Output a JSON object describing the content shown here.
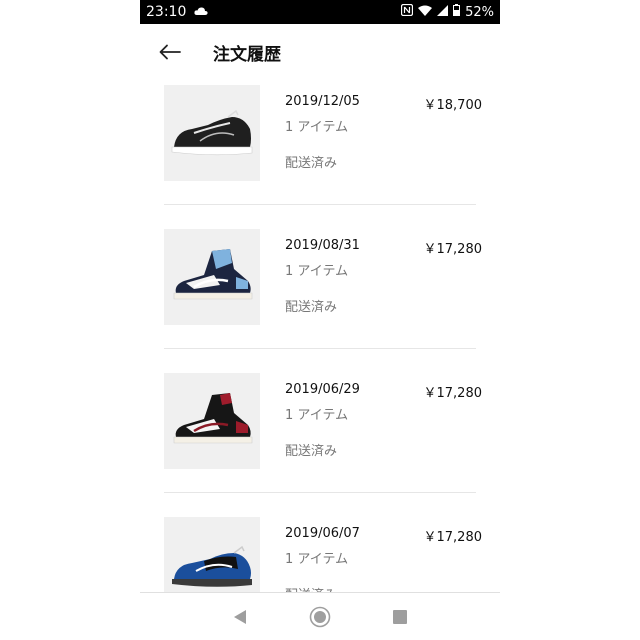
{
  "status_bar": {
    "time": "23:10",
    "battery": "52%",
    "icons": [
      "cloud-icon",
      "nfc-icon",
      "wifi-icon",
      "signal-icon",
      "battery-icon"
    ]
  },
  "header": {
    "title": "注文履歴",
    "back_icon": "arrow-left-icon"
  },
  "orders": [
    {
      "date": "2019/12/05",
      "price": "￥18,700",
      "items": "1 アイテム",
      "status": "配送済み",
      "image": "black-white-runner-sneaker"
    },
    {
      "date": "2019/08/31",
      "price": "￥17,280",
      "items": "1 アイテム",
      "status": "配送済み",
      "image": "navy-blue-high-top-sneaker"
    },
    {
      "date": "2019/06/29",
      "price": "￥17,280",
      "items": "1 アイテム",
      "status": "配送済み",
      "image": "black-red-high-top-sneaker"
    },
    {
      "date": "2019/06/07",
      "price": "￥17,280",
      "items": "1 アイテム",
      "status": "配送済み",
      "image": "blue-black-runner-sneaker"
    }
  ],
  "nav_bar": {
    "buttons": [
      "back-triangle-icon",
      "home-circle-icon",
      "recents-square-icon"
    ]
  }
}
